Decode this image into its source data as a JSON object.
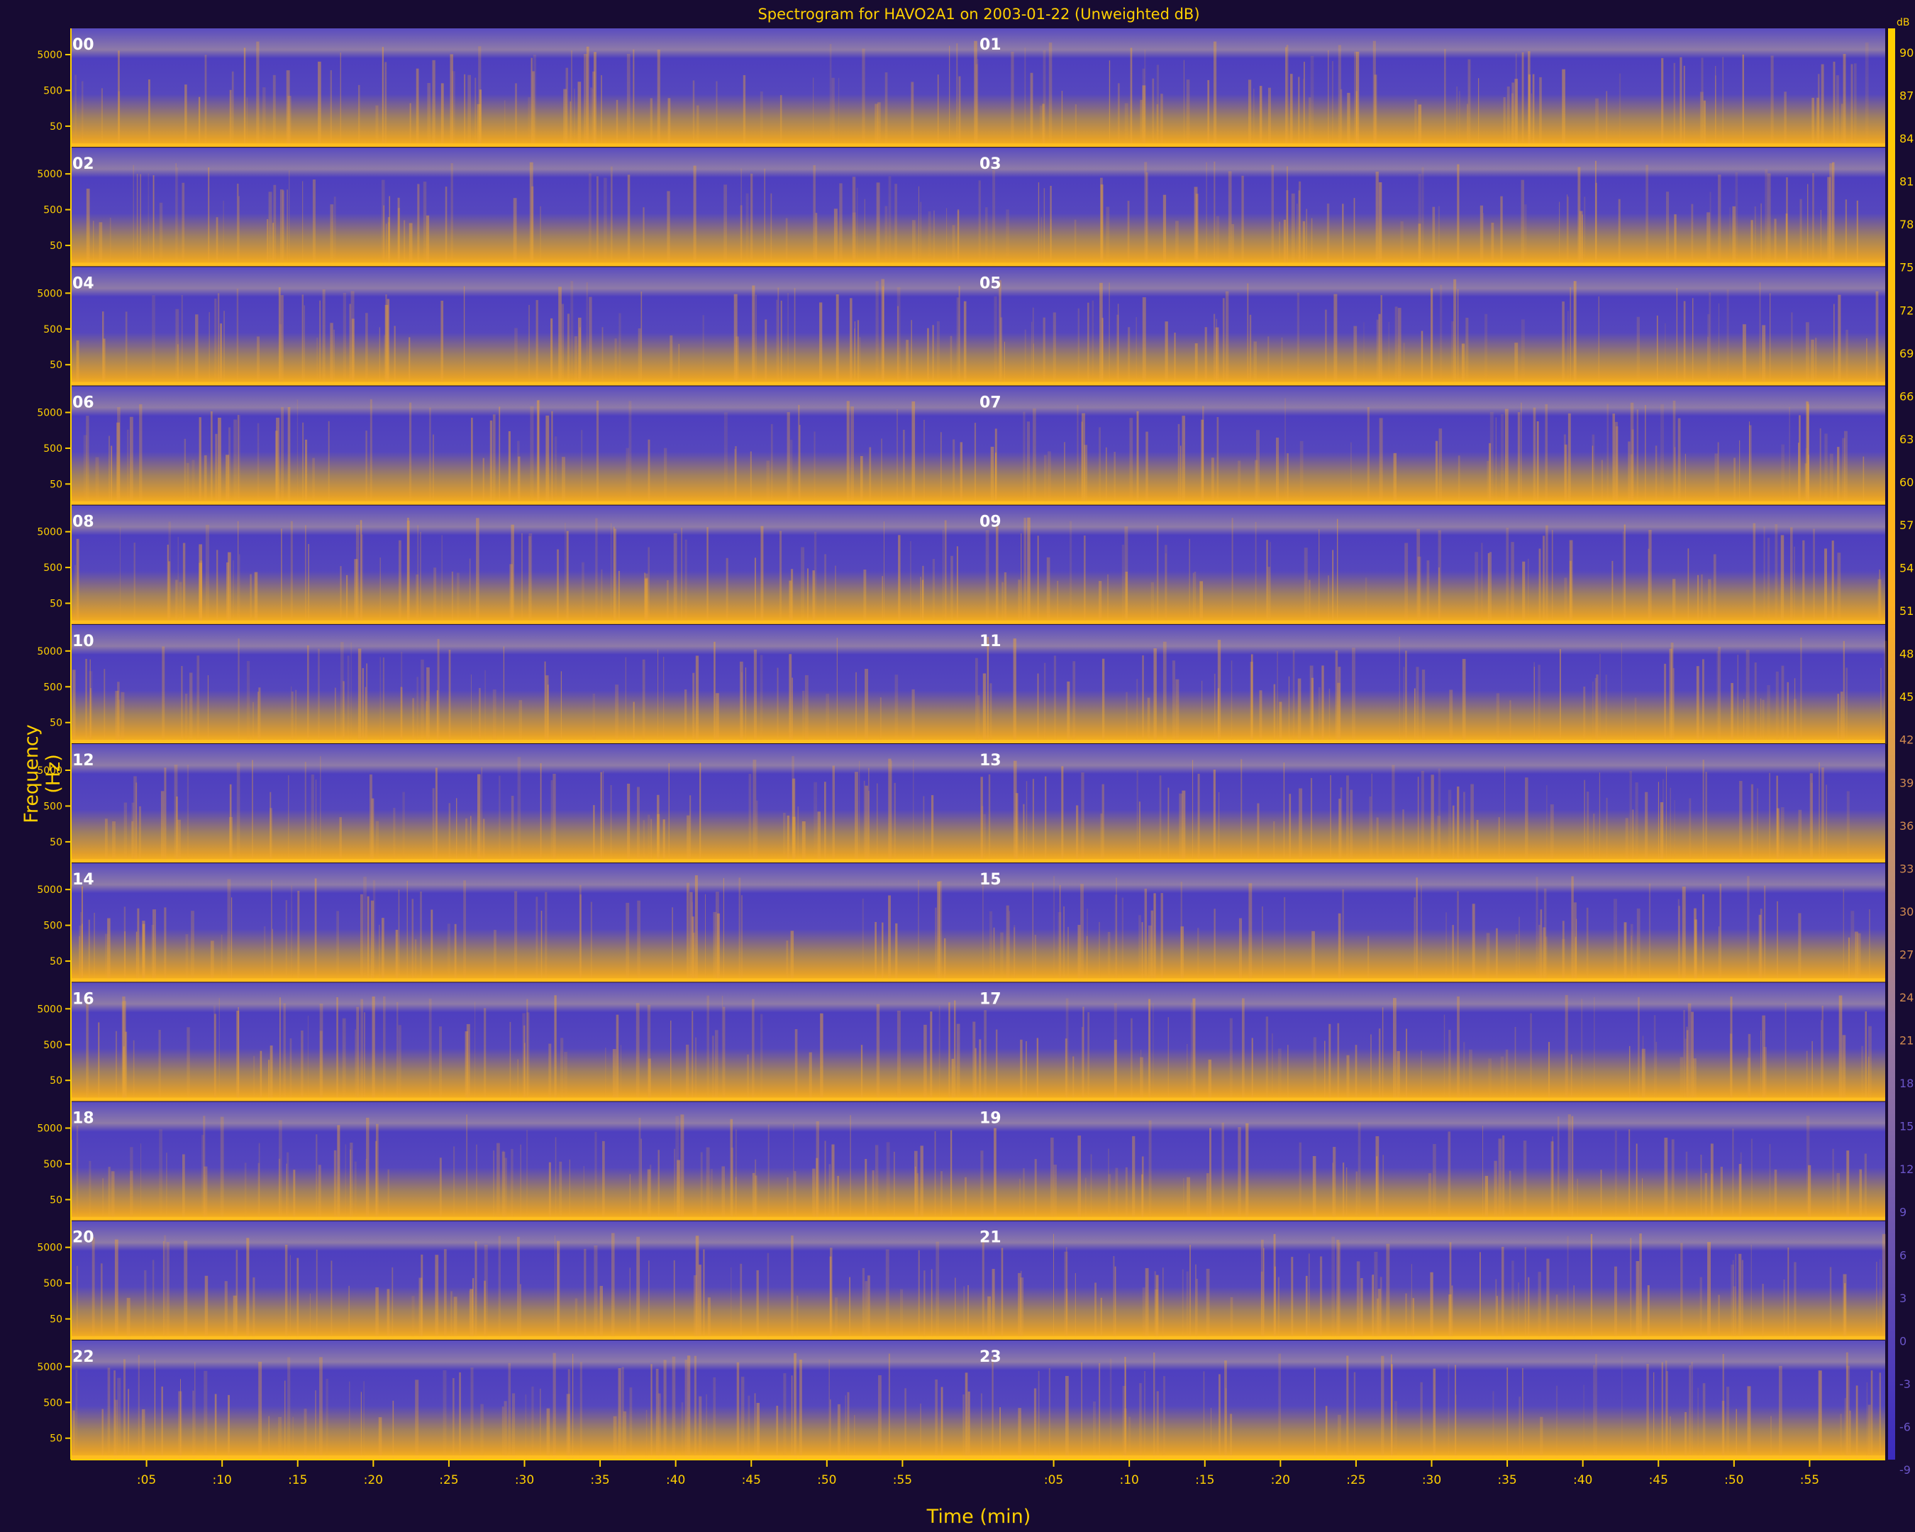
{
  "title": "Spectrogram for HAVO2A1 on 2003-01-22 (Unweighted dB)",
  "ylabel": "Frequency (Hz)",
  "xlabel": "Time (min)",
  "colors": {
    "background": "#170b33",
    "low": "#4a3bbf",
    "mid": "#9a7aa0",
    "high": "#ffb020",
    "axis": "#ffd000"
  },
  "chart_data": {
    "type": "heatmap",
    "title": "Spectrogram for HAVO2A1 on 2003-01-22 (Unweighted dB)",
    "xlabel": "Time (min)",
    "ylabel": "Frequency (Hz)",
    "rows": [
      {
        "hours": [
          "00",
          "01"
        ]
      },
      {
        "hours": [
          "02",
          "03"
        ]
      },
      {
        "hours": [
          "04",
          "05"
        ]
      },
      {
        "hours": [
          "06",
          "07"
        ]
      },
      {
        "hours": [
          "08",
          "09"
        ]
      },
      {
        "hours": [
          "10",
          "11"
        ]
      },
      {
        "hours": [
          "12",
          "13"
        ]
      },
      {
        "hours": [
          "14",
          "15"
        ]
      },
      {
        "hours": [
          "16",
          "17"
        ]
      },
      {
        "hours": [
          "18",
          "19"
        ]
      },
      {
        "hours": [
          "20",
          "21"
        ]
      },
      {
        "hours": [
          "22",
          "23"
        ]
      }
    ],
    "y_tick_labels": [
      "5000",
      "500",
      "50"
    ],
    "x_tick_labels": [
      ":05",
      ":10",
      ":15",
      ":20",
      ":25",
      ":30",
      ":35",
      ":40",
      ":45",
      ":50",
      ":55",
      ":05",
      ":10",
      ":15",
      ":20",
      ":25",
      ":30",
      ":35",
      ":40",
      ":45",
      ":50",
      ":55"
    ],
    "x_range_min": [
      0,
      120
    ],
    "colorbar_unit": "dB",
    "colorbar_ticks": [
      90,
      87,
      84,
      81,
      78,
      75,
      72,
      69,
      66,
      63,
      60,
      57,
      54,
      51,
      48,
      45,
      42,
      39,
      36,
      33,
      30,
      27,
      24,
      21,
      18,
      15,
      12,
      9,
      6,
      3,
      0,
      -3,
      -6,
      -9
    ],
    "colorbar_range": [
      -9,
      90
    ],
    "grid": false
  }
}
